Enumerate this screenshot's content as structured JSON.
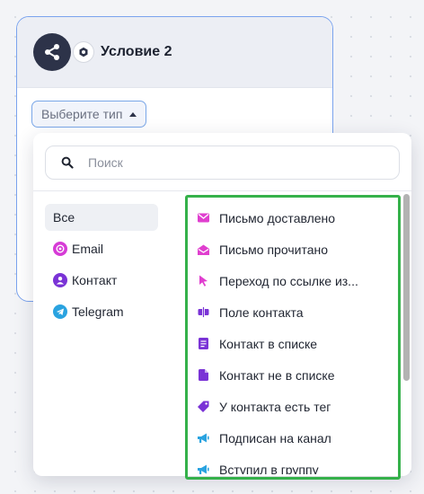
{
  "node": {
    "title": "Условие 2",
    "type_select_label": "Выберите тип"
  },
  "dropdown": {
    "search_placeholder": "Поиск",
    "categories": [
      {
        "label": "Все",
        "icon": "none",
        "active": true
      },
      {
        "label": "Email",
        "icon": "at-sign-icon",
        "color": "#d63bd6"
      },
      {
        "label": "Контакт",
        "icon": "user-icon",
        "color": "#7a33d6"
      },
      {
        "label": "Telegram",
        "icon": "telegram-icon",
        "color": "#2aa3e0"
      }
    ],
    "events": [
      {
        "label": "Письмо доставлено",
        "icon": "envelope-icon",
        "color": "#e03fcf"
      },
      {
        "label": "Письмо прочитано",
        "icon": "envelope-open-icon",
        "color": "#e03fcf"
      },
      {
        "label": "Переход по ссылке из...",
        "icon": "cursor-icon",
        "color": "#e03fcf"
      },
      {
        "label": "Поле контакта",
        "icon": "field-icon",
        "color": "#7a33d6"
      },
      {
        "label": "Контакт в списке",
        "icon": "list-icon",
        "color": "#7a33d6"
      },
      {
        "label": "Контакт не в списке",
        "icon": "list-remove-icon",
        "color": "#7a33d6"
      },
      {
        "label": "У контакта есть тег",
        "icon": "tag-icon",
        "color": "#7a33d6"
      },
      {
        "label": "Подписан на канал",
        "icon": "megaphone-icon",
        "color": "#2aa3e0"
      },
      {
        "label": "Вступил в группу",
        "icon": "megaphone-icon",
        "color": "#2aa3e0"
      }
    ]
  },
  "colors": {
    "highlight": "#35b14a",
    "select_border": "#7aa7e8",
    "node_icon_bg": "#2d3349"
  }
}
